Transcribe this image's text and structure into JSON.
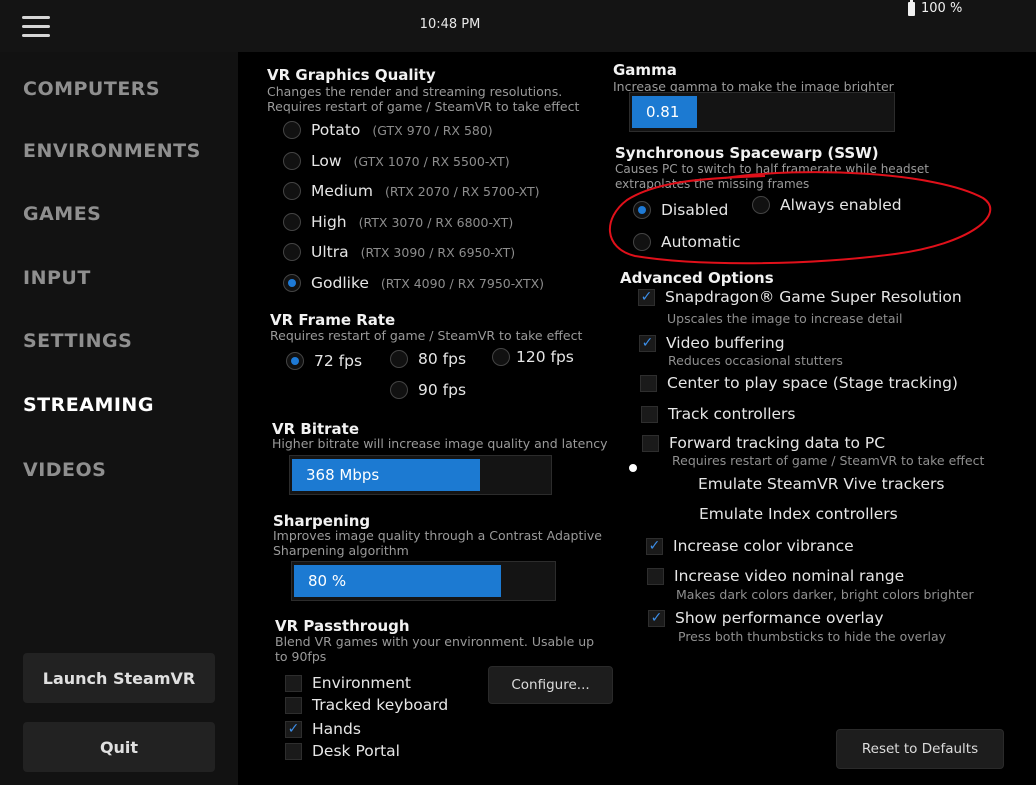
{
  "topbar": {
    "time": "10:48 PM",
    "battery": "100 %"
  },
  "sidebar": {
    "items": [
      "COMPUTERS",
      "ENVIRONMENTS",
      "GAMES",
      "INPUT",
      "SETTINGS",
      "STREAMING",
      "VIDEOS"
    ],
    "active": "STREAMING",
    "launch_label": "Launch SteamVR",
    "quit_label": "Quit"
  },
  "graphics": {
    "title": "VR Graphics Quality",
    "desc1": "Changes the render and streaming resolutions.",
    "desc2": "Requires restart of game / SteamVR to take effect",
    "options": [
      {
        "label": "Potato",
        "hint": "(GTX 970 / RX 580)"
      },
      {
        "label": "Low",
        "hint": "(GTX 1070 / RX 5500-XT)"
      },
      {
        "label": "Medium",
        "hint": "(RTX 2070 / RX 5700-XT)"
      },
      {
        "label": "High",
        "hint": "(RTX 3070 / RX 6800-XT)"
      },
      {
        "label": "Ultra",
        "hint": "(RTX 3090 / RX 6950-XT)"
      },
      {
        "label": "Godlike",
        "hint": "(RTX 4090 / RX 7950-XTX)"
      }
    ],
    "selected": "Godlike"
  },
  "framerate": {
    "title": "VR Frame Rate",
    "desc": "Requires restart of game / SteamVR to take effect",
    "options": [
      "72 fps",
      "80 fps",
      "120 fps",
      "90 fps"
    ],
    "selected": "72 fps"
  },
  "bitrate": {
    "title": "VR Bitrate",
    "desc": "Higher bitrate will increase image quality and latency",
    "value": "368 Mbps",
    "fraction": 0.73
  },
  "sharpening": {
    "title": "Sharpening",
    "desc1": "Improves image quality through a Contrast Adaptive",
    "desc2": "Sharpening algorithm",
    "value": "80 %",
    "fraction": 0.8
  },
  "passthrough": {
    "title": "VR Passthrough",
    "desc1": "Blend VR games with your environment. Usable up",
    "desc2": "to 90fps",
    "options": [
      {
        "label": "Environment",
        "checked": false
      },
      {
        "label": "Tracked keyboard",
        "checked": false
      },
      {
        "label": "Hands",
        "checked": true
      },
      {
        "label": "Desk Portal",
        "checked": false
      }
    ],
    "configure_label": "Configure..."
  },
  "gamma": {
    "title": "Gamma",
    "desc": "Increase gamma to make the image brighter",
    "value": "0.81",
    "fraction": 0.25
  },
  "ssw": {
    "title": "Synchronous Spacewarp (SSW)",
    "desc1": "Causes PC to switch to half framerate while headset",
    "desc2": "extrapolates the missing frames",
    "options": [
      "Disabled",
      "Always enabled",
      "Automatic"
    ],
    "selected": "Disabled"
  },
  "advanced": {
    "title": "Advanced Options",
    "items": [
      {
        "label": "Snapdragon® Game Super Resolution",
        "checked": true,
        "sub": "Upscales the image to increase detail"
      },
      {
        "label": "Video buffering",
        "checked": true,
        "sub": "Reduces occasional stutters"
      },
      {
        "label": "Center to play space (Stage tracking)",
        "checked": false,
        "sub": ""
      },
      {
        "label": "Track controllers",
        "checked": false,
        "sub": ""
      },
      {
        "label": "Forward tracking data to PC",
        "checked": false,
        "sub": "Requires restart of game / SteamVR to take effect"
      }
    ],
    "nested": [
      "Emulate SteamVR Vive trackers",
      "Emulate Index controllers"
    ],
    "items2": [
      {
        "label": "Increase color vibrance",
        "checked": true,
        "sub": ""
      },
      {
        "label": "Increase video nominal range",
        "checked": false,
        "sub": "Makes dark colors darker, bright colors brighter"
      },
      {
        "label": "Show performance overlay",
        "checked": true,
        "sub": "Press both thumbsticks to hide the overlay"
      }
    ]
  },
  "reset_label": "Reset to Defaults",
  "colors": {
    "accent": "#1e7ad6",
    "annotation": "#e0101a",
    "background": "#000000"
  }
}
